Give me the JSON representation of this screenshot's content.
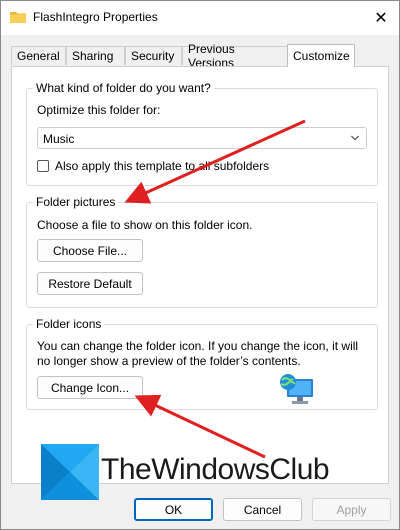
{
  "window": {
    "title": "FlashIntegro Properties",
    "close_label": "✕"
  },
  "tabs": [
    {
      "label": "General"
    },
    {
      "label": "Sharing"
    },
    {
      "label": "Security"
    },
    {
      "label": "Previous Versions"
    },
    {
      "label": "Customize",
      "active": true
    }
  ],
  "folder_type": {
    "legend": "What kind of folder do you want?",
    "optimize_label": "Optimize this folder for:",
    "selected_value": "Music",
    "apply_subfolders_label": "Also apply this template to all subfolders",
    "apply_subfolders_checked": false
  },
  "folder_pictures": {
    "legend": "Folder pictures",
    "description": "Choose a file to show on this folder icon.",
    "choose_button": "Choose File...",
    "restore_button": "Restore Default"
  },
  "folder_icons": {
    "legend": "Folder icons",
    "description_line1": "You can change the folder icon. If you change the icon, it will",
    "description_line2": "no longer show a preview of the folder’s contents.",
    "change_button": "Change Icon..."
  },
  "footer": {
    "ok": "OK",
    "cancel": "Cancel",
    "apply": "Apply"
  },
  "watermark": {
    "text": "TheWindowsClub"
  },
  "colors": {
    "accent": "#0067c0",
    "annotation_arrow": "#e02020",
    "logo_blue": "#1aa0ee"
  }
}
